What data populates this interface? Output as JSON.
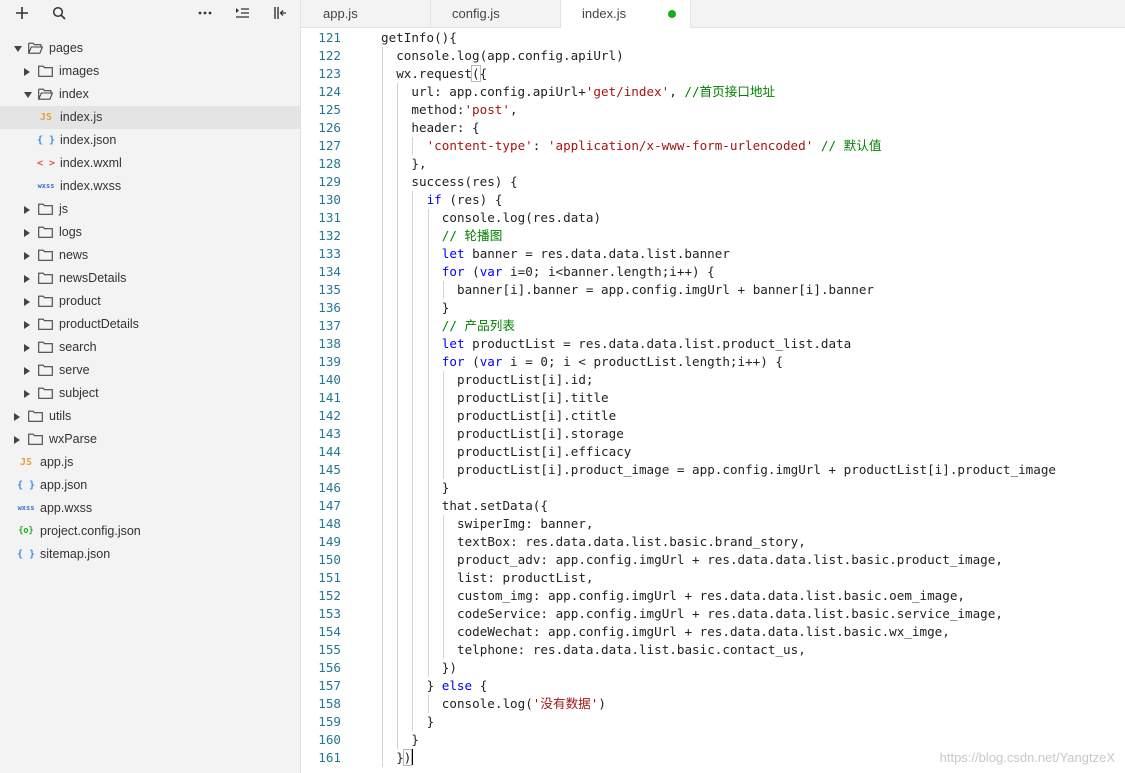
{
  "sidebar": {
    "toolbar": [
      {
        "icon": "plus-icon"
      },
      {
        "icon": "search-icon"
      },
      {
        "icon": "more-icon"
      },
      {
        "icon": "outdent-icon"
      },
      {
        "icon": "collapse-panel-icon"
      }
    ],
    "tree": [
      {
        "label": "pages",
        "depth": 0,
        "kind": "folder",
        "expanded": true
      },
      {
        "label": "images",
        "depth": 1,
        "kind": "folder",
        "expanded": false
      },
      {
        "label": "index",
        "depth": 1,
        "kind": "folder",
        "expanded": true
      },
      {
        "label": "index.js",
        "depth": 2,
        "kind": "js",
        "selected": true
      },
      {
        "label": "index.json",
        "depth": 2,
        "kind": "json"
      },
      {
        "label": "index.wxml",
        "depth": 2,
        "kind": "wxml"
      },
      {
        "label": "index.wxss",
        "depth": 2,
        "kind": "wxss"
      },
      {
        "label": "js",
        "depth": 1,
        "kind": "folder",
        "expanded": false
      },
      {
        "label": "logs",
        "depth": 1,
        "kind": "folder",
        "expanded": false
      },
      {
        "label": "news",
        "depth": 1,
        "kind": "folder",
        "expanded": false
      },
      {
        "label": "newsDetails",
        "depth": 1,
        "kind": "folder",
        "expanded": false
      },
      {
        "label": "product",
        "depth": 1,
        "kind": "folder",
        "expanded": false
      },
      {
        "label": "productDetails",
        "depth": 1,
        "kind": "folder",
        "expanded": false
      },
      {
        "label": "search",
        "depth": 1,
        "kind": "folder",
        "expanded": false
      },
      {
        "label": "serve",
        "depth": 1,
        "kind": "folder",
        "expanded": false
      },
      {
        "label": "subject",
        "depth": 1,
        "kind": "folder",
        "expanded": false
      },
      {
        "label": "utils",
        "depth": 0,
        "kind": "folder",
        "expanded": false
      },
      {
        "label": "wxParse",
        "depth": 0,
        "kind": "folder",
        "expanded": false
      },
      {
        "label": "app.js",
        "depth": 0,
        "kind": "js"
      },
      {
        "label": "app.json",
        "depth": 0,
        "kind": "json"
      },
      {
        "label": "app.wxss",
        "depth": 0,
        "kind": "wxss"
      },
      {
        "label": "project.config.json",
        "depth": 0,
        "kind": "config"
      },
      {
        "label": "sitemap.json",
        "depth": 0,
        "kind": "json"
      }
    ],
    "file_tags": {
      "js": "JS",
      "json": "{ }",
      "wxml": "< >",
      "wxss": "wxss",
      "config": "{o}"
    }
  },
  "tabs": [
    {
      "label": "app.js",
      "active": false
    },
    {
      "label": "config.js",
      "active": false
    },
    {
      "label": "index.js",
      "active": true,
      "modified": true
    }
  ],
  "colors": {
    "js": "#e6a23c",
    "json": "#3a8ee6",
    "wxml": "#e8543f",
    "wxss": "#3a6fd8",
    "config": "#1aad19",
    "modified_dot": "#1aad19"
  },
  "editor": {
    "lines": [
      {
        "n": "121",
        "indent": 0,
        "tokens": [
          [
            "p",
            "getInfo(){"
          ]
        ]
      },
      {
        "n": "122",
        "indent": 1,
        "tokens": [
          [
            "p",
            "console.log(app.config.apiUrl)"
          ]
        ]
      },
      {
        "n": "123",
        "indent": 1,
        "tokens": [
          [
            "p",
            "wx.request"
          ],
          [
            "b",
            "("
          ],
          [
            "p",
            "{"
          ]
        ]
      },
      {
        "n": "124",
        "indent": 2,
        "tokens": [
          [
            "p",
            "url: app.config.apiUrl+"
          ],
          [
            "s",
            "'get/index'"
          ],
          [
            "p",
            ", "
          ],
          [
            "c",
            "//首页接口地址"
          ]
        ]
      },
      {
        "n": "125",
        "indent": 2,
        "tokens": [
          [
            "p",
            "method:"
          ],
          [
            "s",
            "'post'"
          ],
          [
            "p",
            ","
          ]
        ]
      },
      {
        "n": "126",
        "indent": 2,
        "tokens": [
          [
            "p",
            "header: {"
          ]
        ]
      },
      {
        "n": "127",
        "indent": 3,
        "tokens": [
          [
            "s",
            "'content-type'"
          ],
          [
            "p",
            ": "
          ],
          [
            "s",
            "'application/x-www-form-urlencoded'"
          ],
          [
            "p",
            " "
          ],
          [
            "c",
            "// 默认值"
          ]
        ]
      },
      {
        "n": "128",
        "indent": 2,
        "tokens": [
          [
            "p",
            "},"
          ]
        ]
      },
      {
        "n": "129",
        "indent": 2,
        "tokens": [
          [
            "p",
            "success(res) {"
          ]
        ]
      },
      {
        "n": "130",
        "indent": 3,
        "tokens": [
          [
            "k",
            "if"
          ],
          [
            "p",
            " (res) {"
          ]
        ]
      },
      {
        "n": "131",
        "indent": 4,
        "tokens": [
          [
            "p",
            "console.log(res.data)"
          ]
        ]
      },
      {
        "n": "132",
        "indent": 4,
        "tokens": [
          [
            "c",
            "// 轮播图"
          ]
        ]
      },
      {
        "n": "133",
        "indent": 4,
        "tokens": [
          [
            "k",
            "let"
          ],
          [
            "p",
            " banner = res.data.data.list.banner"
          ]
        ]
      },
      {
        "n": "134",
        "indent": 4,
        "tokens": [
          [
            "k",
            "for"
          ],
          [
            "p",
            " ("
          ],
          [
            "k",
            "var"
          ],
          [
            "p",
            " i=0; i<banner.length;i++) {"
          ]
        ]
      },
      {
        "n": "135",
        "indent": 5,
        "tokens": [
          [
            "p",
            "banner[i].banner = app.config.imgUrl + banner[i].banner"
          ]
        ]
      },
      {
        "n": "136",
        "indent": 4,
        "tokens": [
          [
            "p",
            "}"
          ]
        ]
      },
      {
        "n": "137",
        "indent": 4,
        "tokens": [
          [
            "c",
            "// 产品列表"
          ]
        ]
      },
      {
        "n": "138",
        "indent": 4,
        "tokens": [
          [
            "k",
            "let"
          ],
          [
            "p",
            " productList = res.data.data.list.product_list.data"
          ]
        ]
      },
      {
        "n": "139",
        "indent": 4,
        "tokens": [
          [
            "k",
            "for"
          ],
          [
            "p",
            " ("
          ],
          [
            "k",
            "var"
          ],
          [
            "p",
            " i = 0; i < productList.length;i++) {"
          ]
        ]
      },
      {
        "n": "140",
        "indent": 5,
        "tokens": [
          [
            "p",
            "productList[i].id;"
          ]
        ]
      },
      {
        "n": "141",
        "indent": 5,
        "tokens": [
          [
            "p",
            "productList[i].title"
          ]
        ]
      },
      {
        "n": "142",
        "indent": 5,
        "tokens": [
          [
            "p",
            "productList[i].ctitle"
          ]
        ]
      },
      {
        "n": "143",
        "indent": 5,
        "tokens": [
          [
            "p",
            "productList[i].storage"
          ]
        ]
      },
      {
        "n": "144",
        "indent": 5,
        "tokens": [
          [
            "p",
            "productList[i].efficacy"
          ]
        ]
      },
      {
        "n": "145",
        "indent": 5,
        "tokens": [
          [
            "p",
            "productList[i].product_image = app.config.imgUrl + productList[i].product_image"
          ]
        ]
      },
      {
        "n": "146",
        "indent": 4,
        "tokens": [
          [
            "p",
            "}"
          ]
        ]
      },
      {
        "n": "147",
        "indent": 4,
        "tokens": [
          [
            "p",
            "that.setData({"
          ]
        ]
      },
      {
        "n": "148",
        "indent": 5,
        "tokens": [
          [
            "p",
            "swiperImg: banner,"
          ]
        ]
      },
      {
        "n": "149",
        "indent": 5,
        "tokens": [
          [
            "p",
            "textBox: res.data.data.list.basic.brand_story,"
          ]
        ]
      },
      {
        "n": "150",
        "indent": 5,
        "tokens": [
          [
            "p",
            "product_adv: app.config.imgUrl + res.data.data.list.basic.product_image,"
          ]
        ]
      },
      {
        "n": "151",
        "indent": 5,
        "tokens": [
          [
            "p",
            "list: productList,"
          ]
        ]
      },
      {
        "n": "152",
        "indent": 5,
        "tokens": [
          [
            "p",
            "custom_img: app.config.imgUrl + res.data.data.list.basic.oem_image,"
          ]
        ]
      },
      {
        "n": "153",
        "indent": 5,
        "tokens": [
          [
            "p",
            "codeService: app.config.imgUrl + res.data.data.list.basic.service_image,"
          ]
        ]
      },
      {
        "n": "154",
        "indent": 5,
        "tokens": [
          [
            "p",
            "codeWechat: app.config.imgUrl + res.data.data.list.basic.wx_imge,"
          ]
        ]
      },
      {
        "n": "155",
        "indent": 5,
        "tokens": [
          [
            "p",
            "telphone: res.data.data.list.basic.contact_us,"
          ]
        ]
      },
      {
        "n": "156",
        "indent": 4,
        "tokens": [
          [
            "p",
            "})"
          ]
        ]
      },
      {
        "n": "157",
        "indent": 3,
        "tokens": [
          [
            "p",
            "} "
          ],
          [
            "k",
            "else"
          ],
          [
            "p",
            " {"
          ]
        ]
      },
      {
        "n": "158",
        "indent": 4,
        "tokens": [
          [
            "p",
            "console.log("
          ],
          [
            "s",
            "'没有数据'"
          ],
          [
            "p",
            ")"
          ]
        ]
      },
      {
        "n": "159",
        "indent": 3,
        "tokens": [
          [
            "p",
            "}"
          ]
        ]
      },
      {
        "n": "160",
        "indent": 2,
        "tokens": [
          [
            "p",
            "}"
          ]
        ]
      },
      {
        "n": "161",
        "indent": 1,
        "tokens": [
          [
            "p",
            "}"
          ],
          [
            "b",
            ")"
          ],
          [
            "cur",
            ""
          ]
        ]
      }
    ]
  },
  "watermark": "https://blog.csdn.net/YangtzeX"
}
